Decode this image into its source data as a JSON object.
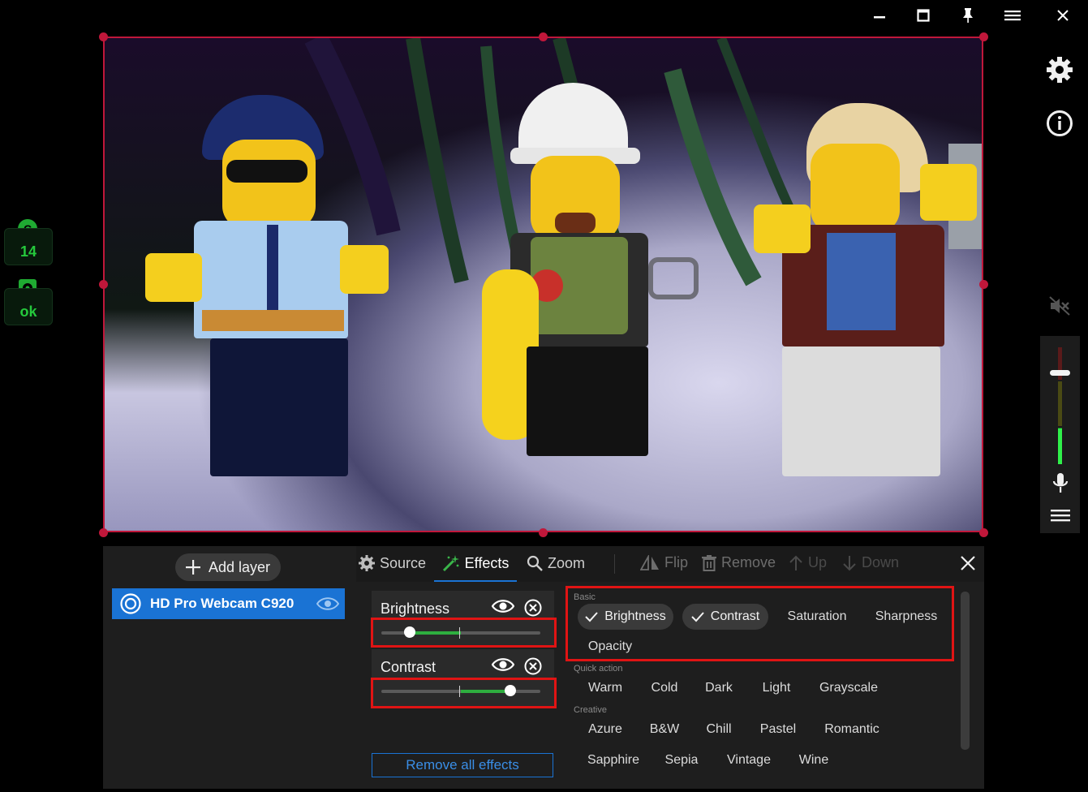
{
  "window": {
    "buttons": [
      "minimize",
      "maximize",
      "pin",
      "menu",
      "close"
    ]
  },
  "status": {
    "counter_badge": "C",
    "counter_value": "14",
    "health_value": "ok"
  },
  "panel": {
    "add_layer_label": "Add layer",
    "layer_name": "HD Pro Webcam C920",
    "tabs": [
      {
        "label": "Source"
      },
      {
        "label": "Effects"
      },
      {
        "label": "Zoom"
      }
    ],
    "tools": [
      {
        "label": "Flip"
      },
      {
        "label": "Remove"
      },
      {
        "label": "Up"
      },
      {
        "label": "Down"
      }
    ],
    "applied_effects": [
      {
        "label": "Brightness",
        "value": 0.18
      },
      {
        "label": "Contrast",
        "value": 0.81
      }
    ],
    "remove_all_label": "Remove all effects",
    "catalog": {
      "basic_label": "Basic",
      "basic": [
        "Brightness",
        "Contrast",
        "Saturation",
        "Sharpness",
        "Opacity"
      ],
      "quick_label": "Quick action",
      "quick": [
        "Warm",
        "Cold",
        "Dark",
        "Light",
        "Grayscale"
      ],
      "creative_label": "Creative",
      "creative": [
        "Azure",
        "B&W",
        "Chill",
        "Pastel",
        "Romantic",
        "Sapphire",
        "Sepia",
        "Vintage",
        "Wine"
      ]
    }
  },
  "colors": {
    "accent": "#1a73d4",
    "selection": "#c0173a",
    "highlight": "#e01414",
    "status_green": "#25c93c"
  }
}
